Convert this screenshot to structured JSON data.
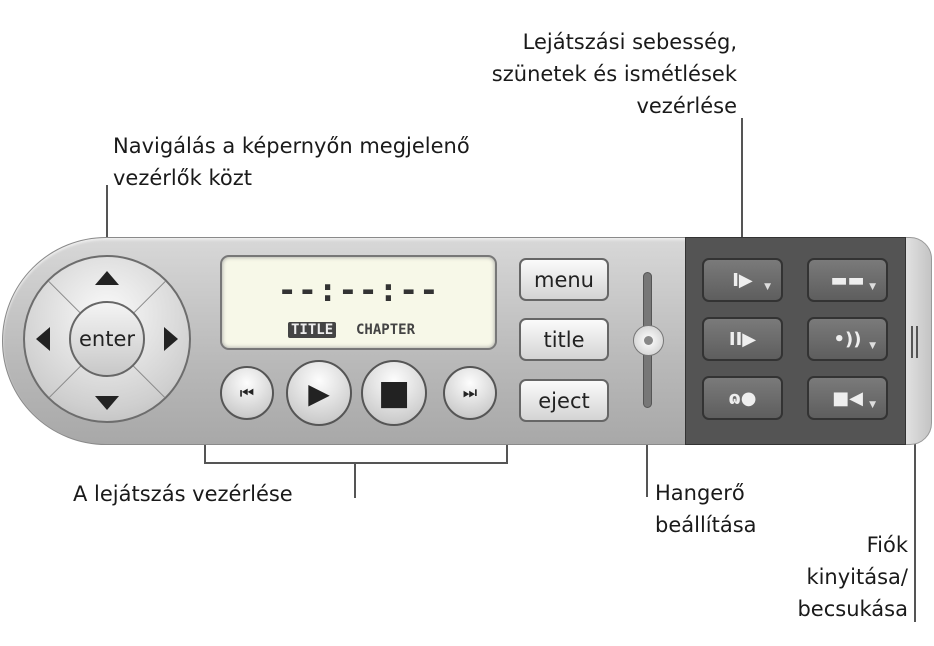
{
  "callouts": {
    "navigation": [
      "Navigálás a képernyőn megjelenő",
      "vezérlők közt"
    ],
    "speed": [
      "Lejátszási sebesség,",
      "szünetek és ismétlések",
      "vezérlése"
    ],
    "playback": "A lejátszás vezérlése",
    "volume": [
      "Hangerő",
      "beállítása"
    ],
    "drawer": [
      "Fiók",
      "kinyitása/",
      "becsukása"
    ]
  },
  "dpad": {
    "enter_label": "enter"
  },
  "lcd": {
    "time": "--:--:--",
    "title_tag": "TITLE",
    "chapter_tag": "CHAPTER"
  },
  "transport": {
    "prev": "⏮",
    "play": "▶",
    "stop": "■",
    "next": "⏭"
  },
  "side_buttons": {
    "menu": "menu",
    "title": "title",
    "eject": "eject"
  },
  "drawer_buttons": [
    {
      "icon": "slow-motion-icon",
      "glyph": "I▶",
      "dropdown": true
    },
    {
      "icon": "subtitles-icon",
      "glyph": "▬▬",
      "dropdown": true
    },
    {
      "icon": "step-frame-icon",
      "glyph": "II▶",
      "dropdown": false
    },
    {
      "icon": "audio-icon",
      "glyph": "•))",
      "dropdown": true
    },
    {
      "icon": "return-icon",
      "glyph": "ɷ●",
      "dropdown": false
    },
    {
      "icon": "camera-angle-icon",
      "glyph": "■◀",
      "dropdown": true
    }
  ],
  "colors": {
    "body": "#c4c4c4",
    "drawer": "#545454",
    "lcd": "#f7f8e8"
  }
}
